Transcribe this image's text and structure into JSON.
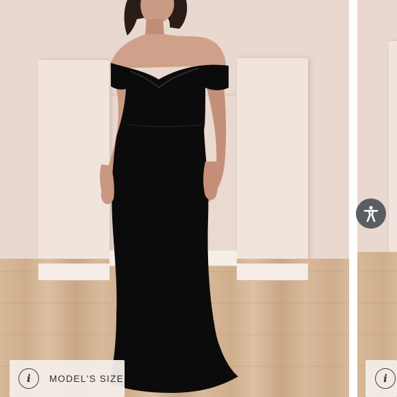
{
  "gallery": {
    "main_image": {
      "alt": "Model wearing black velvet off-the-shoulder gown",
      "info_chip": {
        "icon": "info-icon",
        "icon_glyph": "i",
        "label": "MODEL'S SIZE"
      }
    },
    "next_image": {
      "info_chip": {
        "icon": "info-icon",
        "icon_glyph": "i"
      }
    },
    "accessibility_button": {
      "icon": "accessibility-icon"
    }
  },
  "colors": {
    "wall": "#e9d8cf",
    "gown": "#0b0b0c",
    "chip_bg": "#f3ece6",
    "accessibility_bg": "#5a5e63"
  }
}
